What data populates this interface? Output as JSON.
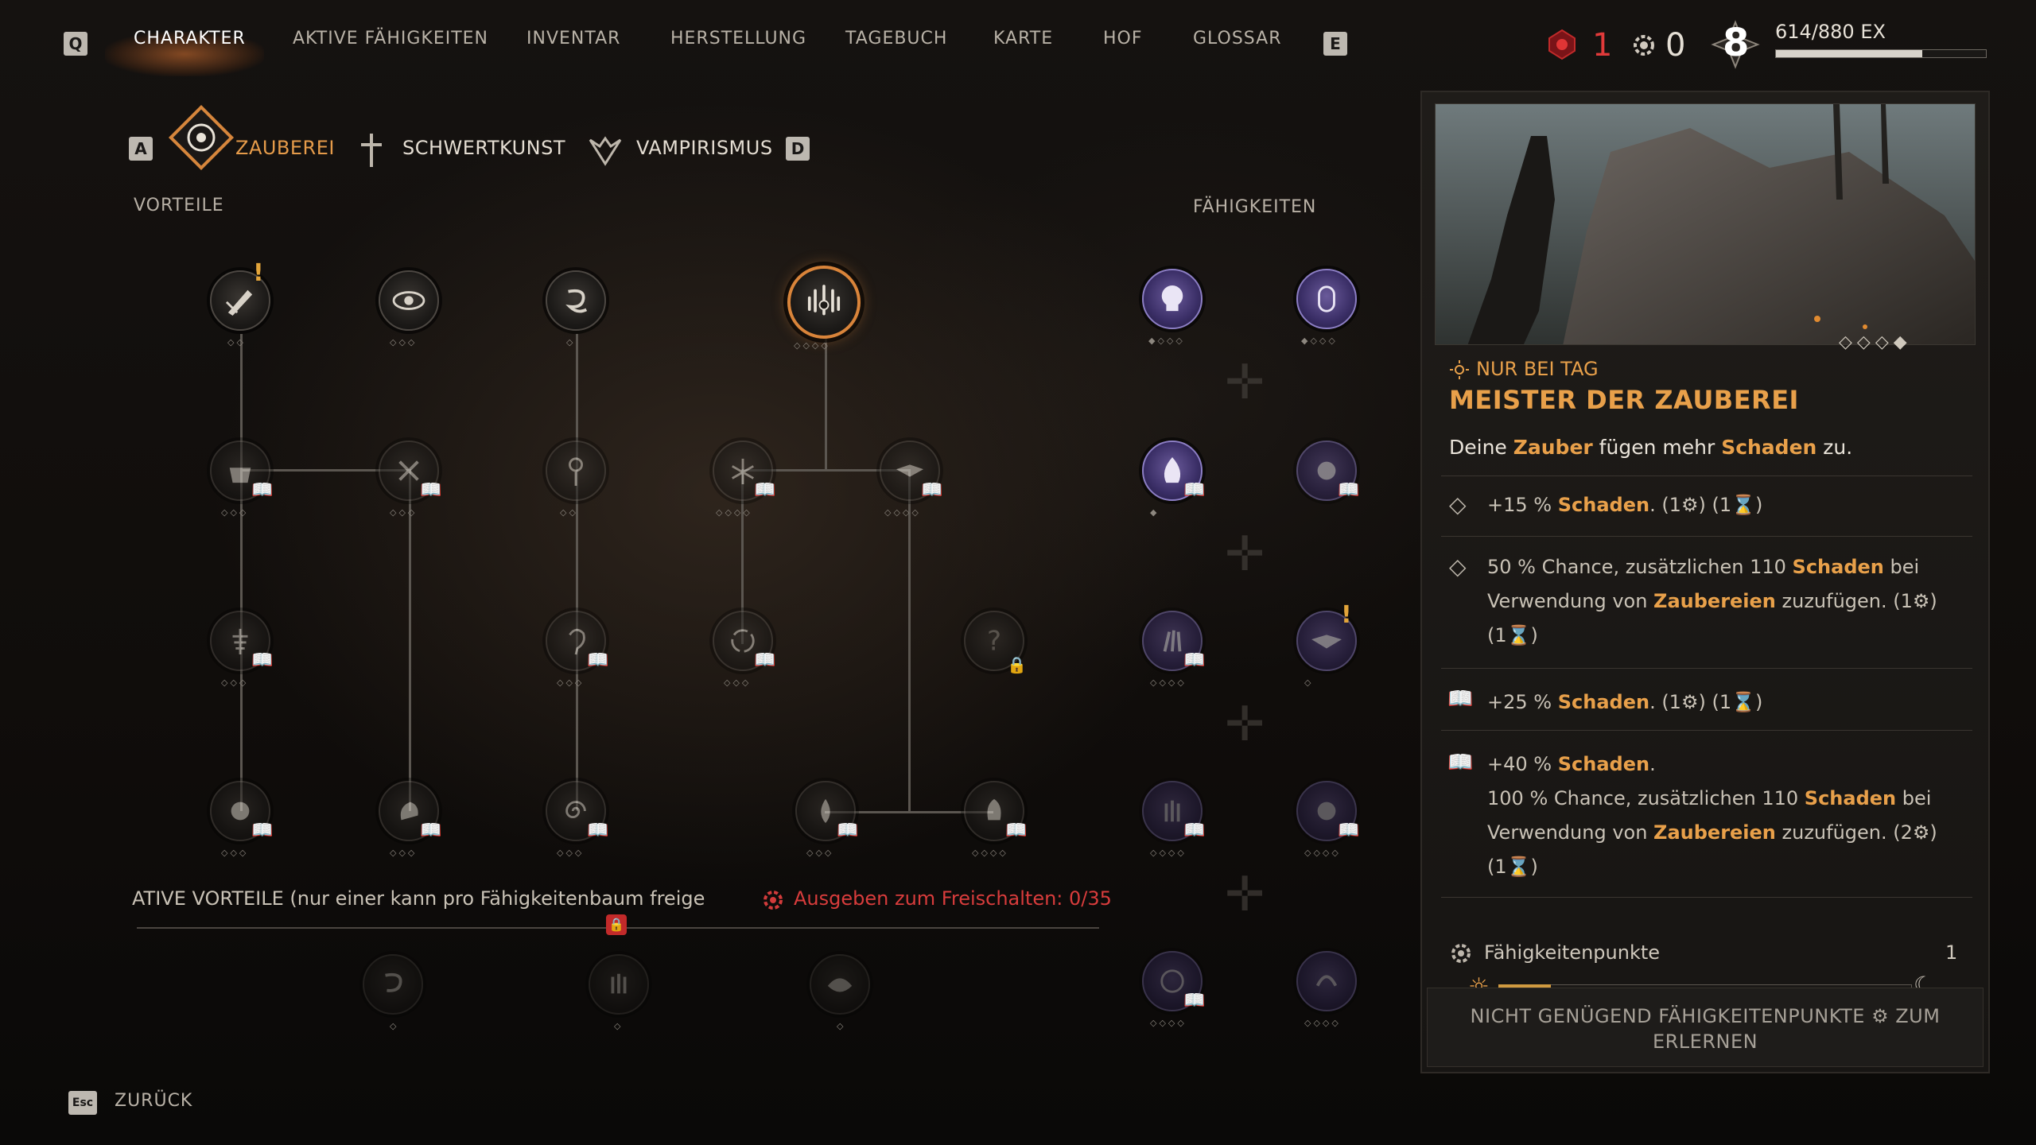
{
  "nav": {
    "key_left": "Q",
    "key_right": "E",
    "items": [
      "CHARAKTER",
      "AKTIVE FÄHIGKEITEN",
      "INVENTAR",
      "HERSTELLUNG",
      "TAGEBUCH",
      "KARTE",
      "HOF",
      "GLOSSAR"
    ]
  },
  "resources": {
    "red_count": "1",
    "skill_points": "0",
    "level": "8",
    "xp_label": "614/880 EX",
    "xp_fraction": 0.698
  },
  "tabs": {
    "key_left": "A",
    "key_right": "D",
    "items": [
      "ZAUBEREI",
      "SCHWERTKUNST",
      "VAMPIRISMUS"
    ]
  },
  "sections": {
    "perks": "VORTEILE",
    "abilities": "FÄHIGKEITEN"
  },
  "active_perks": {
    "label": "ATIVE VORTEILE (nur einer kann pro Fähigkeitenbaum freigesc",
    "unlock": "Ausgeben zum Freischalten: 0/35"
  },
  "back": {
    "key": "Esc",
    "label": "ZURÜCK"
  },
  "detail": {
    "condition": "NUR BEI TAG",
    "title": "MEISTER DER ZAUBEREI",
    "desc": [
      "Deine ",
      "Zauber",
      " fügen mehr ",
      "Schaden",
      " zu."
    ],
    "stat1": [
      "+15 % ",
      "Schaden",
      ". (1",
      ") (1",
      ")"
    ],
    "stat2_l1": [
      "50 % Chance, zusätzlichen 110 ",
      "Schaden",
      " bei"
    ],
    "stat2_l2": [
      "Verwendung von ",
      "Zaubereien",
      " zuzufügen. (1",
      ")"
    ],
    "stat2_l3": [
      "(1",
      ")"
    ],
    "stat3": [
      "+25 % ",
      "Schaden",
      ". (1",
      ") (1",
      ")"
    ],
    "stat4_l1": [
      "+40 % ",
      "Schaden",
      "."
    ],
    "stat4_l2": [
      "100 % Chance, zusätzlichen 110 ",
      "Schaden",
      " bei"
    ],
    "stat4_l3": [
      "Verwendung von ",
      "Zaubereien",
      " zuzufügen. (2",
      ")"
    ],
    "stat4_l4": [
      "(1",
      ")"
    ],
    "points_label": "Fähigkeitenpunkte",
    "points_value": "1",
    "warning_l1a": "NICHT GENÜGEND FÄHIGKEITENPUNKTE",
    "warning_l1b": "ZUM",
    "warning_l2": "ERLERNEN"
  }
}
